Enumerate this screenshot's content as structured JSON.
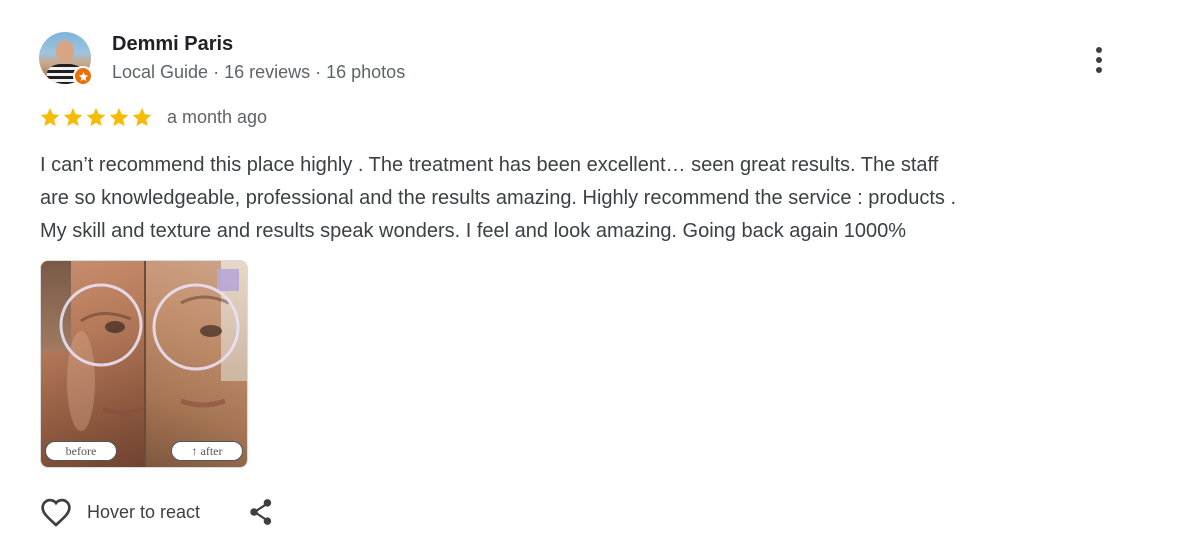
{
  "reviewer": {
    "name": "Demmi Paris",
    "badge": "Local Guide",
    "reviews": "16 reviews",
    "photos": "16 photos",
    "separator": " · "
  },
  "review": {
    "rating": 5,
    "rating_max": 5,
    "time": "a month ago",
    "text_lines": [
      "I can’t recommend this place highly . The treatment has been excellent… seen great results. The staff",
      "are so knowledgeable, professional and the results amazing. Highly recommend the service : products .",
      "My skill and texture and results speak wonders. I feel and look amazing. Going back again 1000%"
    ]
  },
  "photo": {
    "before_label": "before",
    "after_label": "↑ after"
  },
  "actions": {
    "react_label": "Hover to react"
  },
  "colors": {
    "star": "#f6bb06",
    "guide_badge": "#e8710a",
    "secondary_text": "#5f6368",
    "body_text": "#3c4043"
  },
  "icons": {
    "more": "more-vert-icon",
    "heart": "heart-outline-icon",
    "share": "share-icon",
    "star": "star-icon"
  }
}
